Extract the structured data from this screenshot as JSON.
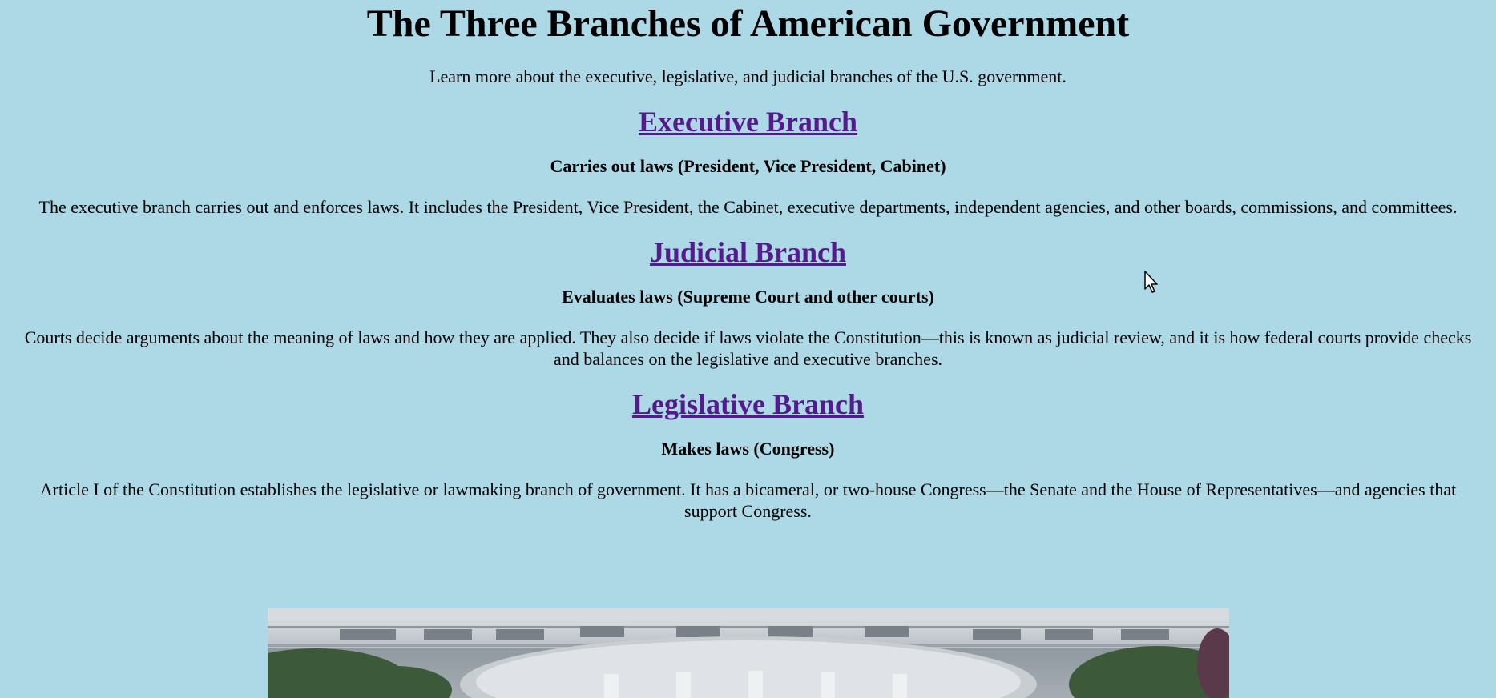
{
  "page": {
    "title": "The Three Branches of American Government",
    "intro": "Learn more about the executive, legislative, and judicial branches of the U.S. government."
  },
  "branches": [
    {
      "heading": "Executive Branch",
      "subtitle": "Carries out laws (President, Vice President, Cabinet)",
      "description": "The executive branch carries out and enforces laws. It includes the President, Vice President, the Cabinet, executive departments, independent agencies, and other boards, commissions, and committees."
    },
    {
      "heading": "Judicial Branch",
      "subtitle": "Evaluates laws (Supreme Court and other courts)",
      "description": "Courts decide arguments about the meaning of laws and how they are applied. They also decide if laws violate the Constitution—this is known as judicial review, and it is how federal courts provide checks and balances on the legislative and executive branches."
    },
    {
      "heading": "Legislative Branch",
      "subtitle": "Makes laws (Congress)",
      "description": "Article I of the Constitution establishes the legislative or lawmaking branch of government. It has a bicameral, or two-house Congress—the Senate and the House of Representatives—and agencies that support Congress."
    }
  ],
  "colors": {
    "background": "#add8e6",
    "link": "#551a8b"
  },
  "icons": {
    "cursor": "mouse-pointer-icon"
  }
}
